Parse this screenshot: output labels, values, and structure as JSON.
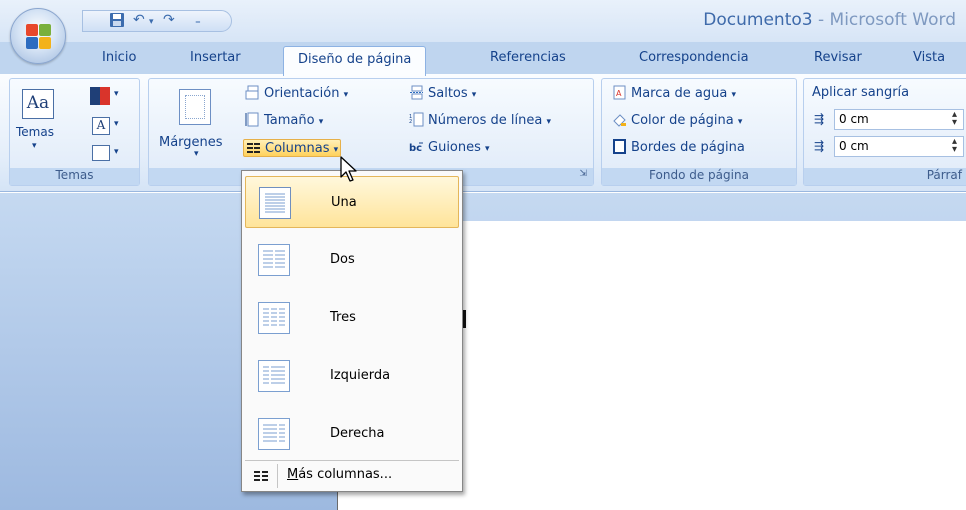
{
  "window": {
    "title_doc": "Documento3",
    "title_app": " - Microsoft Word"
  },
  "tabs": [
    {
      "label": "Inicio"
    },
    {
      "label": "Insertar"
    },
    {
      "label": "Diseño de página",
      "active": true
    },
    {
      "label": "Referencias"
    },
    {
      "label": "Correspondencia"
    },
    {
      "label": "Revisar"
    },
    {
      "label": "Vista"
    }
  ],
  "ribbon": {
    "temas": {
      "button": "Temas",
      "group_label": "Temas"
    },
    "config_pagina": {
      "margenes": "Márgenes",
      "orientacion": "Orientación",
      "tamano": "Tamaño",
      "columnas": "Columnas",
      "saltos": "Saltos",
      "numeros_linea": "Números de línea",
      "guiones": "Guiones"
    },
    "fondo": {
      "marca_agua": "Marca de agua",
      "color_pagina": "Color de página",
      "bordes_pagina": "Bordes de página",
      "group_label": "Fondo de página"
    },
    "parrafo": {
      "aplicar_sangria": "Aplicar sangría",
      "sangria_izq": "0 cm",
      "sangria_der": "0 cm",
      "group_label": "Párraf"
    }
  },
  "columns_menu": {
    "items": [
      {
        "label": "Una",
        "columns": 1,
        "selected": true
      },
      {
        "label": "Dos",
        "columns": 2
      },
      {
        "label": "Tres",
        "columns": 3
      },
      {
        "label": "Izquierda",
        "columns": 2
      },
      {
        "label": "Derecha",
        "columns": 2
      }
    ],
    "more_prefix": "M",
    "more_rest": "ás columnas..."
  },
  "icons": {
    "office": "office-button-icon",
    "save": "save-icon",
    "undo": "undo-icon",
    "redo": "redo-icon",
    "columns": "columns-icon",
    "cursor": "mouse-pointer-icon"
  }
}
